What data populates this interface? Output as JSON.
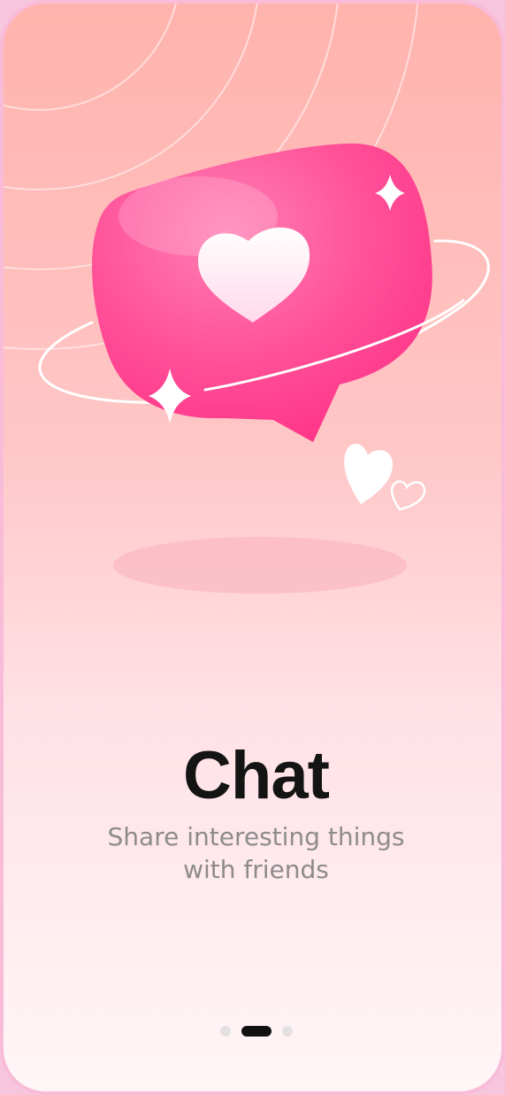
{
  "onboarding": {
    "title": "Chat",
    "subtitle_line1": "Share interesting things",
    "subtitle_line2": "with friends"
  },
  "pager": {
    "page_count": 3,
    "active_index": 1
  },
  "colors": {
    "accent": "#ff3f8e",
    "title_text": "#141414",
    "subtitle_text": "#8e8b8c",
    "dot_active": "#111111",
    "dot_inactive": "#e5e1e2"
  },
  "icons": {
    "hero": "chat-bubble-heart-icon"
  }
}
